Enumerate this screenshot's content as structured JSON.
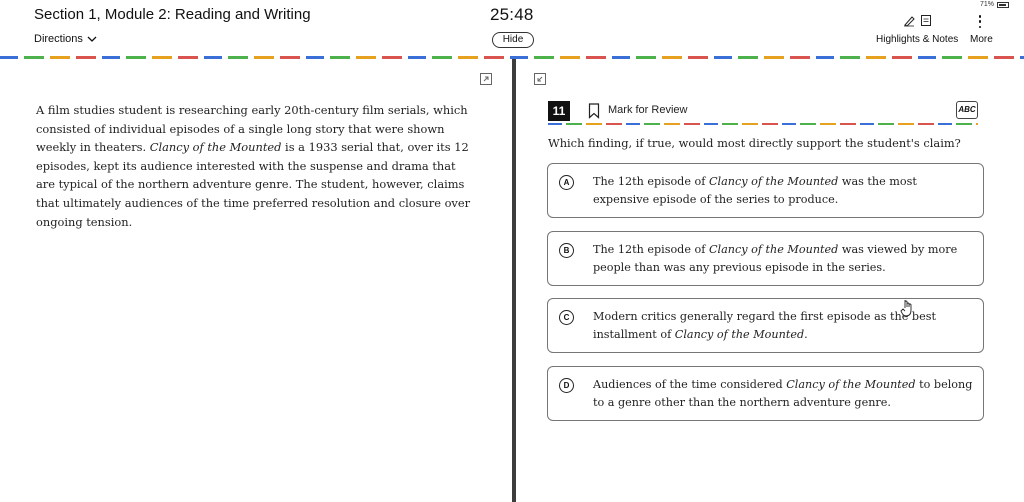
{
  "header": {
    "section_title": "Section 1, Module 2: Reading and Writing",
    "directions_label": "Directions",
    "timer": "25:48",
    "hide_label": "Hide",
    "battery_percent": "71%",
    "highlights_label": "Highlights & Notes",
    "more_label": "More"
  },
  "passage": {
    "p1": "A film studies student is researching early 20th-century film serials, which consisted of individual episodes of a single long story that were shown weekly in theaters. ",
    "title1": "Clancy of the Mounted",
    "p2": " is a 1933 serial that, over its 12 episodes, kept its audience interested with the suspense and drama that are typical of the northern adventure genre. The student, however, claims that ultimately audiences of the time preferred resolution and closure over ongoing tension."
  },
  "question": {
    "number": "11",
    "mark_label": "Mark for Review",
    "abc_label": "ABC",
    "prompt": "Which finding, if true, would most directly support the student's claim?",
    "options": [
      {
        "letter": "A",
        "pre": "The 12th episode of ",
        "title": "Clancy of the Mounted",
        "post": " was the most expensive episode of the series to produce."
      },
      {
        "letter": "B",
        "pre": "The 12th episode of ",
        "title": "Clancy of the Mounted",
        "post": " was viewed by more people than was any previous episode in the series."
      },
      {
        "letter": "C",
        "pre": "Modern critics generally regard the first episode as the best installment of ",
        "title": "Clancy of the Mounted",
        "post": "."
      },
      {
        "letter": "D",
        "pre": "Audiences of the time considered ",
        "title": "Clancy of the Mounted",
        "post": " to belong to a genre other than the northern adventure genre."
      }
    ]
  },
  "colors": {
    "accent_blue": "#3a6fd8",
    "accent_green": "#4db14c",
    "accent_orange": "#e6a21e",
    "accent_red": "#d9534f",
    "divider_dark": "#3d3d3d"
  }
}
